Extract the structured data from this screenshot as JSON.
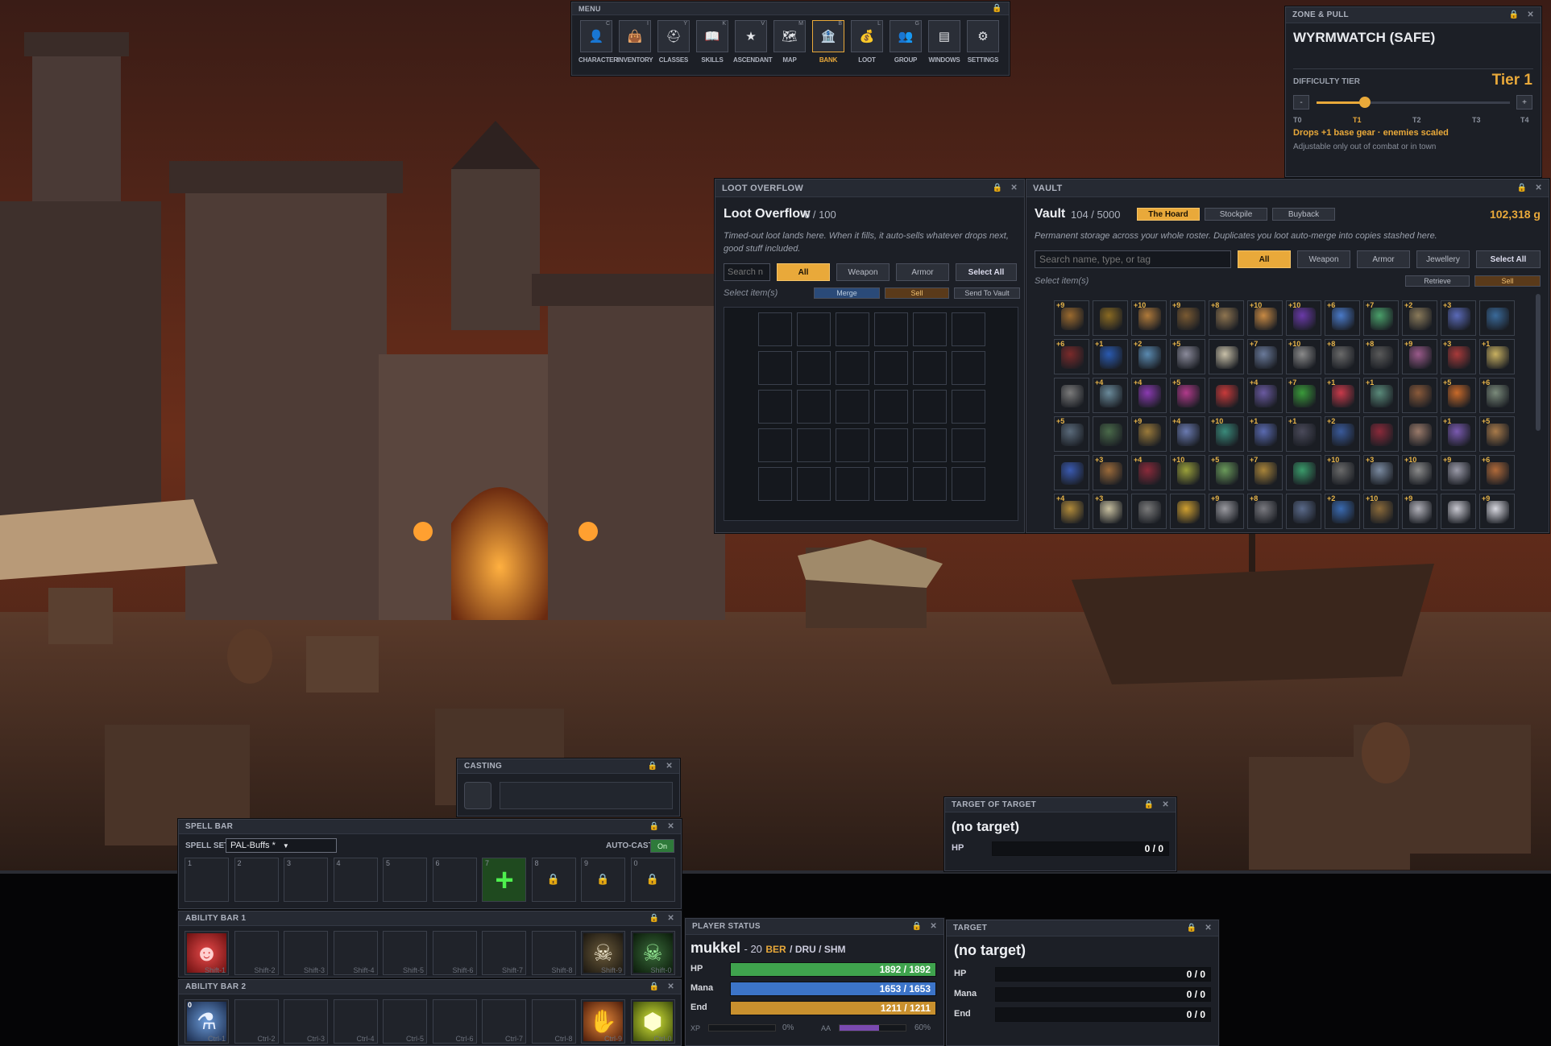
{
  "menu": {
    "title": "MENU",
    "items": [
      {
        "label": "CHARACTER",
        "key": "C",
        "icon": "person-icon"
      },
      {
        "label": "INVENTORY",
        "key": "I",
        "icon": "bag-icon"
      },
      {
        "label": "CLASSES",
        "key": "Y",
        "icon": "helmet-icon"
      },
      {
        "label": "SKILLS",
        "key": "K",
        "icon": "book-icon"
      },
      {
        "label": "ASCENDANT",
        "key": "V",
        "icon": "star-icon"
      },
      {
        "label": "MAP",
        "key": "M",
        "icon": "map-icon"
      },
      {
        "label": "BANK",
        "key": "B",
        "icon": "bank-icon"
      },
      {
        "label": "LOOT",
        "key": "L",
        "icon": "loot-icon"
      },
      {
        "label": "GROUP",
        "key": "G",
        "icon": "group-icon"
      },
      {
        "label": "WINDOWS",
        "key": "",
        "icon": "windows-icon"
      },
      {
        "label": "SETTINGS",
        "key": "",
        "icon": "gear-icon"
      }
    ],
    "active": "BANK"
  },
  "zone": {
    "title": "ZONE & PULL",
    "name": "WYRMWATCH (SAFE)",
    "difficulty_label": "DIFFICULTY TIER",
    "tier": "Tier 1",
    "minus": "-",
    "plus": "+",
    "tiers": [
      "T0",
      "T1",
      "T2",
      "T3",
      "T4"
    ],
    "slider_level": 0.25,
    "effect": "Drops +1 base gear · enemies scaled",
    "note": "Adjustable only out of combat or in town"
  },
  "loot": {
    "title": "LOOT OVERFLOW",
    "heading": "Loot Overflow",
    "count": "0 / 100",
    "desc": "Timed-out loot lands here. When it fills, it auto-sells whatever drops next, good stuff included.",
    "search_placeholder": "Search n",
    "filters": [
      "All",
      "Weapon",
      "Armor"
    ],
    "select_all": "Select All",
    "select_items": "Select item(s)",
    "merge": "Merge",
    "sell": "Sell",
    "send": "Send To Vault"
  },
  "vault": {
    "title": "VAULT",
    "heading": "Vault",
    "count": "104 / 5000",
    "tabs": [
      "The Hoard",
      "Stockpile",
      "Buyback"
    ],
    "gold": "102,318 g",
    "desc": "Permanent storage across your whole roster. Duplicates you loot auto-merge into copies stashed here.",
    "search_placeholder": "Search name, type, or tag",
    "filters": [
      "All",
      "Weapon",
      "Armor",
      "Jewellery"
    ],
    "select_all": "Select All",
    "select_items": "Select item(s)",
    "retrieve": "Retrieve",
    "sell": "Sell",
    "items": [
      {
        "n": "+9",
        "c": "#9b6a2e"
      },
      {
        "n": "",
        "c": "#8a6a22"
      },
      {
        "n": "+10",
        "c": "#b07a3a"
      },
      {
        "n": "+9",
        "c": "#7a5a32"
      },
      {
        "n": "+8",
        "c": "#8f7550"
      },
      {
        "n": "+10",
        "c": "#c88a44"
      },
      {
        "n": "+10",
        "c": "#6a3aa8"
      },
      {
        "n": "+6",
        "c": "#4a7ac8"
      },
      {
        "n": "+7",
        "c": "#4aa06a"
      },
      {
        "n": "+2",
        "c": "#8a7a5a"
      },
      {
        "n": "+3",
        "c": "#5a6ab8"
      },
      {
        "n": "",
        "c": "#3a6a9a"
      },
      {
        "n": "+6",
        "c": "#7a2a2a"
      },
      {
        "n": "+1",
        "c": "#2a5ab0"
      },
      {
        "n": "+2",
        "c": "#5a8ab0"
      },
      {
        "n": "+5",
        "c": "#8a8a9a"
      },
      {
        "n": "",
        "c": "#c8c0a8"
      },
      {
        "n": "+7",
        "c": "#6a7a9a"
      },
      {
        "n": "+10",
        "c": "#8a8a8a"
      },
      {
        "n": "+8",
        "c": "#6a6a6a"
      },
      {
        "n": "+8",
        "c": "#5a5a5a"
      },
      {
        "n": "+9",
        "c": "#9a5a8a"
      },
      {
        "n": "+3",
        "c": "#a83a3a"
      },
      {
        "n": "+1",
        "c": "#c8b060"
      },
      {
        "n": "",
        "c": "#7a7a7a"
      },
      {
        "n": "+4",
        "c": "#6a8a9a"
      },
      {
        "n": "+4",
        "c": "#8a3ab0"
      },
      {
        "n": "+5",
        "c": "#b03a8a"
      },
      {
        "n": "",
        "c": "#c83a3a"
      },
      {
        "n": "+4",
        "c": "#6a5aa0"
      },
      {
        "n": "+7",
        "c": "#3a9a3a"
      },
      {
        "n": "+1",
        "c": "#c83a4a"
      },
      {
        "n": "+1",
        "c": "#5a8a7a"
      },
      {
        "n": "",
        "c": "#8a5a3a"
      },
      {
        "n": "+5",
        "c": "#c86a2a"
      },
      {
        "n": "+6",
        "c": "#7a8a7a"
      },
      {
        "n": "+5",
        "c": "#5a6a7a"
      },
      {
        "n": "",
        "c": "#4a6a4a"
      },
      {
        "n": "+9",
        "c": "#9a7a3a"
      },
      {
        "n": "+4",
        "c": "#6a7ab0"
      },
      {
        "n": "+10",
        "c": "#3a8a7a"
      },
      {
        "n": "+1",
        "c": "#5a6ab0"
      },
      {
        "n": "+1",
        "c": "#4a4a5a"
      },
      {
        "n": "+2",
        "c": "#3a5a9a"
      },
      {
        "n": "",
        "c": "#8a2a3a"
      },
      {
        "n": "",
        "c": "#9a7a6a"
      },
      {
        "n": "+1",
        "c": "#7a5ab0"
      },
      {
        "n": "+5",
        "c": "#a87a4a"
      },
      {
        "n": "",
        "c": "#3a5ab0"
      },
      {
        "n": "+3",
        "c": "#9a6a3a"
      },
      {
        "n": "+4",
        "c": "#8a2a3a"
      },
      {
        "n": "+10",
        "c": "#9aa03a"
      },
      {
        "n": "+5",
        "c": "#6a9a5a"
      },
      {
        "n": "+7",
        "c": "#a8843a"
      },
      {
        "n": "",
        "c": "#3a9a6a"
      },
      {
        "n": "+10",
        "c": "#6a6a6a"
      },
      {
        "n": "+3",
        "c": "#7a8aa0"
      },
      {
        "n": "+10",
        "c": "#8a8a8a"
      },
      {
        "n": "+9",
        "c": "#9a9aa8"
      },
      {
        "n": "+6",
        "c": "#b06a3a"
      },
      {
        "n": "+4",
        "c": "#b08a3a"
      },
      {
        "n": "+3",
        "c": "#c8c0a0"
      },
      {
        "n": "",
        "c": "#7a7a7a"
      },
      {
        "n": "",
        "c": "#d0a030"
      },
      {
        "n": "+9",
        "c": "#9a9aa0"
      },
      {
        "n": "+8",
        "c": "#7a7a80"
      },
      {
        "n": "",
        "c": "#5a6a8a"
      },
      {
        "n": "+2",
        "c": "#3a6ab0"
      },
      {
        "n": "+10",
        "c": "#8a6a3a"
      },
      {
        "n": "+9",
        "c": "#b0b0b8"
      },
      {
        "n": "",
        "c": "#c8c8d0"
      },
      {
        "n": "+9",
        "c": "#d8d8e0"
      }
    ]
  },
  "casting": {
    "title": "CASTING"
  },
  "target_of_target": {
    "title": "TARGET OF TARGET",
    "name": "(no target)",
    "hp_label": "HP",
    "hp": "0 / 0"
  },
  "spellbar": {
    "title": "SPELL BAR",
    "set_label": "SPELL SET",
    "set_value": "PAL-Buffs *",
    "autocast_label": "AUTO-CAST",
    "autocast_value": "On",
    "slots": [
      "1",
      "2",
      "3",
      "4",
      "5",
      "6",
      "7",
      "8",
      "9",
      "0"
    ]
  },
  "ability1": {
    "title": "ABILITY BAR 1",
    "keys": [
      "Shift-1",
      "Shift-2",
      "Shift-3",
      "Shift-4",
      "Shift-5",
      "Shift-6",
      "Shift-7",
      "Shift-8",
      "Shift-9",
      "Shift-0"
    ]
  },
  "ability2": {
    "title": "ABILITY BAR 2",
    "first": "0",
    "keys": [
      "Ctrl-1",
      "Ctrl-2",
      "Ctrl-3",
      "Ctrl-4",
      "Ctrl-5",
      "Ctrl-6",
      "Ctrl-7",
      "Ctrl-8",
      "Ctrl-9",
      "Ctrl-0"
    ]
  },
  "player": {
    "title": "PLAYER STATUS",
    "name": "mukkel",
    "level": "- 20",
    "class": "BER",
    "sub": "/ DRU / SHM",
    "hp_label": "HP",
    "hp": "1892 / 1892",
    "hp_frac": 1.0,
    "mana_label": "Mana",
    "mana": "1653 / 1653",
    "mana_frac": 1.0,
    "end_label": "End",
    "end": "1211 / 1211",
    "end_frac": 1.0,
    "xp_label": "XP",
    "xp": "0%",
    "xp_frac": 0.0,
    "aa_label": "AA",
    "aa": "60%",
    "aa_frac": 0.6,
    "colors": {
      "hp": "#3fa34d",
      "mana": "#3c74c8",
      "end": "#c8902e",
      "aa": "#7a4ab0"
    }
  },
  "target": {
    "title": "TARGET",
    "name": "(no target)",
    "hp_label": "HP",
    "hp": "0 / 0",
    "mana_label": "Mana",
    "mana": "0 / 0",
    "end_label": "End",
    "end": "0 / 0"
  }
}
